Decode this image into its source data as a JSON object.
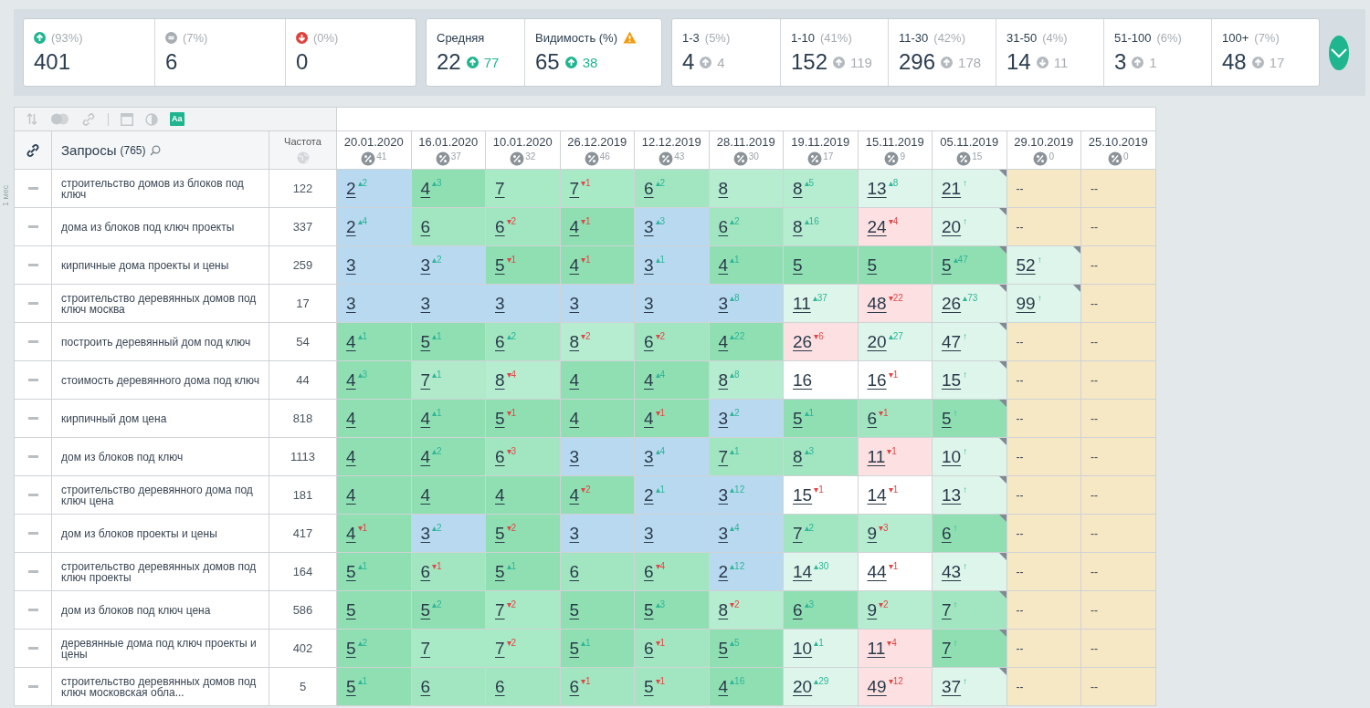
{
  "summary": {
    "trend": [
      {
        "kind": "up",
        "percent": "(93%)",
        "value": "401"
      },
      {
        "kind": "same",
        "percent": "(7%)",
        "value": "6"
      },
      {
        "kind": "down",
        "percent": "(0%)",
        "value": "0"
      }
    ],
    "metrics": [
      {
        "label": "Средняя",
        "warning": false,
        "value": "22",
        "delta": "77",
        "kind": "up"
      },
      {
        "label": "Видимость (%)",
        "warning": true,
        "value": "65",
        "delta": "38",
        "kind": "up"
      }
    ],
    "ranges": [
      {
        "label": "1-3",
        "percent": "(5%)",
        "value": "4",
        "delta": "4",
        "kind": "up"
      },
      {
        "label": "1-10",
        "percent": "(41%)",
        "value": "152",
        "delta": "119",
        "kind": "up"
      },
      {
        "label": "11-30",
        "percent": "(42%)",
        "value": "296",
        "delta": "178",
        "kind": "up"
      },
      {
        "label": "31-50",
        "percent": "(4%)",
        "value": "14",
        "delta": "11",
        "kind": "down"
      },
      {
        "label": "51-100",
        "percent": "(6%)",
        "value": "3",
        "delta": "1",
        "kind": "up"
      },
      {
        "label": "100+",
        "percent": "(7%)",
        "value": "48",
        "delta": "17",
        "kind": "up"
      }
    ]
  },
  "side_label": "1 мес",
  "toolbar": [
    {
      "kind": "sort",
      "active": false
    },
    {
      "kind": "toggle",
      "active": false
    },
    {
      "kind": "link",
      "active": false
    },
    {
      "kind": "separator"
    },
    {
      "kind": "window",
      "active": false
    },
    {
      "kind": "contrast",
      "active": false
    },
    {
      "kind": "text",
      "label": "Aa",
      "active": true
    }
  ],
  "table": {
    "query_header": "Запросы",
    "query_count": "(765)",
    "freq_header": "Частота",
    "dates": [
      {
        "date": "20.01.2020",
        "visibility": "41"
      },
      {
        "date": "16.01.2020",
        "visibility": "37"
      },
      {
        "date": "10.01.2020",
        "visibility": "32"
      },
      {
        "date": "26.12.2019",
        "visibility": "46"
      },
      {
        "date": "12.12.2019",
        "visibility": "43"
      },
      {
        "date": "28.11.2019",
        "visibility": "30"
      },
      {
        "date": "19.11.2019",
        "visibility": "17"
      },
      {
        "date": "15.11.2019",
        "visibility": "9"
      },
      {
        "date": "05.11.2019",
        "visibility": "15"
      },
      {
        "date": "29.10.2019",
        "visibility": "0"
      },
      {
        "date": "25.10.2019",
        "visibility": "0"
      }
    ],
    "rows": [
      {
        "query": "строительство домов из блоков под ключ",
        "frequency": "122",
        "cells": [
          {
            "kind": "up",
            "value": "2",
            "delta": "▴2",
            "color": "#b9d9f1",
            "flagged": false
          },
          {
            "kind": "up",
            "value": "4",
            "delta": "▴3",
            "color": "#8fdfb2",
            "flagged": false
          },
          {
            "kind": "same",
            "value": "7",
            "color": "#a8e9c6",
            "flagged": false
          },
          {
            "kind": "down",
            "value": "7",
            "delta": "▾1",
            "color": "#a8e9c6",
            "flagged": false
          },
          {
            "kind": "up",
            "value": "6",
            "delta": "▴2",
            "color": "#a2e6c1",
            "flagged": false
          },
          {
            "kind": "same",
            "value": "8",
            "color": "#b6ecd0",
            "flagged": false
          },
          {
            "kind": "up",
            "value": "8",
            "delta": "▴5",
            "color": "#b6ecd0",
            "flagged": false
          },
          {
            "kind": "up",
            "value": "13",
            "delta": "▴8",
            "color": "#ddf5ea",
            "flagged": false
          },
          {
            "kind": "new",
            "value": "21",
            "delta": "↑",
            "color": "#ddf5ea",
            "flagged": true
          },
          {
            "kind": "empty",
            "value": "--",
            "color": "#f6e7c5",
            "flagged": false
          },
          {
            "kind": "empty",
            "value": "--",
            "color": "#f6e7c5",
            "flagged": false
          }
        ]
      },
      {
        "query": "дома из блоков под ключ проекты",
        "frequency": "337",
        "cells": [
          {
            "kind": "up",
            "value": "2",
            "delta": "▴4",
            "color": "#b9d9f1",
            "flagged": false
          },
          {
            "kind": "same",
            "value": "6",
            "color": "#a2e6c1",
            "flagged": false
          },
          {
            "kind": "down",
            "value": "6",
            "delta": "▾2",
            "color": "#a2e6c1",
            "flagged": false
          },
          {
            "kind": "down",
            "value": "4",
            "delta": "▾1",
            "color": "#8fdfb2",
            "flagged": false
          },
          {
            "kind": "up",
            "value": "3",
            "delta": "▴3",
            "color": "#b9d9f1",
            "flagged": false
          },
          {
            "kind": "up",
            "value": "6",
            "delta": "▴2",
            "color": "#a2e6c1",
            "flagged": false
          },
          {
            "kind": "up",
            "value": "8",
            "delta": "▴16",
            "color": "#b6ecd0",
            "flagged": false
          },
          {
            "kind": "down",
            "value": "24",
            "delta": "▾4",
            "color": "#fde1e2",
            "flagged": false
          },
          {
            "kind": "new",
            "value": "20",
            "delta": "↑",
            "color": "#ddf5ea",
            "flagged": true
          },
          {
            "kind": "empty",
            "value": "--",
            "color": "#f6e7c5",
            "flagged": false
          },
          {
            "kind": "empty",
            "value": "--",
            "color": "#f6e7c5",
            "flagged": false
          }
        ]
      },
      {
        "query": "кирпичные дома проекты и цены",
        "frequency": "259",
        "cells": [
          {
            "kind": "same",
            "value": "3",
            "color": "#b9d9f1",
            "flagged": false
          },
          {
            "kind": "up",
            "value": "3",
            "delta": "▴2",
            "color": "#b9d9f1",
            "flagged": false
          },
          {
            "kind": "down",
            "value": "5",
            "delta": "▾1",
            "color": "#8fdfb2",
            "flagged": false
          },
          {
            "kind": "down",
            "value": "4",
            "delta": "▾1",
            "color": "#8fdfb2",
            "flagged": false
          },
          {
            "kind": "up",
            "value": "3",
            "delta": "▴1",
            "color": "#b9d9f1",
            "flagged": false
          },
          {
            "kind": "up",
            "value": "4",
            "delta": "▴1",
            "color": "#8fdfb2",
            "flagged": false
          },
          {
            "kind": "same",
            "value": "5",
            "color": "#8fdfb2",
            "flagged": false
          },
          {
            "kind": "same",
            "value": "5",
            "color": "#8fdfb2",
            "flagged": false
          },
          {
            "kind": "up",
            "value": "5",
            "delta": "▴47",
            "color": "#8fdfb2",
            "flagged": true
          },
          {
            "kind": "new",
            "value": "52",
            "delta": "↑",
            "color": "#ddf5ea",
            "flagged": true
          },
          {
            "kind": "empty",
            "value": "--",
            "color": "#f6e7c5",
            "flagged": false
          }
        ]
      },
      {
        "query": "строительство деревянных домов под ключ москва",
        "frequency": "17",
        "cells": [
          {
            "kind": "same",
            "value": "3",
            "color": "#b9d9f1",
            "flagged": false
          },
          {
            "kind": "same",
            "value": "3",
            "color": "#b9d9f1",
            "flagged": false
          },
          {
            "kind": "same",
            "value": "3",
            "color": "#b9d9f1",
            "flagged": false
          },
          {
            "kind": "same",
            "value": "3",
            "color": "#b9d9f1",
            "flagged": false
          },
          {
            "kind": "same",
            "value": "3",
            "color": "#b9d9f1",
            "flagged": false
          },
          {
            "kind": "up",
            "value": "3",
            "delta": "▴8",
            "color": "#b9d9f1",
            "flagged": false
          },
          {
            "kind": "up",
            "value": "11",
            "delta": "▴37",
            "color": "#ddf5ea",
            "flagged": false
          },
          {
            "kind": "down",
            "value": "48",
            "delta": "▾22",
            "color": "#fde1e2",
            "flagged": false
          },
          {
            "kind": "up",
            "value": "26",
            "delta": "▴73",
            "color": "#ddf5ea",
            "flagged": true
          },
          {
            "kind": "new",
            "value": "99",
            "delta": "↑",
            "color": "#ddf5ea",
            "flagged": true
          },
          {
            "kind": "empty",
            "value": "--",
            "color": "#f6e7c5",
            "flagged": false
          }
        ]
      },
      {
        "query": "построить деревянный дом под ключ",
        "frequency": "54",
        "cells": [
          {
            "kind": "up",
            "value": "4",
            "delta": "▴1",
            "color": "#8fdfb2",
            "flagged": false
          },
          {
            "kind": "up",
            "value": "5",
            "delta": "▴1",
            "color": "#8fdfb2",
            "flagged": false
          },
          {
            "kind": "up",
            "value": "6",
            "delta": "▴2",
            "color": "#a2e6c1",
            "flagged": false
          },
          {
            "kind": "down",
            "value": "8",
            "delta": "▾2",
            "color": "#b6ecd0",
            "flagged": false
          },
          {
            "kind": "down",
            "value": "6",
            "delta": "▾2",
            "color": "#a2e6c1",
            "flagged": false
          },
          {
            "kind": "up",
            "value": "4",
            "delta": "▴22",
            "color": "#8fdfb2",
            "flagged": false
          },
          {
            "kind": "down",
            "value": "26",
            "delta": "▾6",
            "color": "#fde1e2",
            "flagged": false
          },
          {
            "kind": "up",
            "value": "20",
            "delta": "▴27",
            "color": "#ddf5ea",
            "flagged": false
          },
          {
            "kind": "new",
            "value": "47",
            "delta": "↑",
            "color": "#ddf5ea",
            "flagged": true
          },
          {
            "kind": "empty",
            "value": "--",
            "color": "#f6e7c5",
            "flagged": false
          },
          {
            "kind": "empty",
            "value": "--",
            "color": "#f6e7c5",
            "flagged": false
          }
        ]
      },
      {
        "query": "стоимость деревянного дома под ключ",
        "frequency": "44",
        "cells": [
          {
            "kind": "up",
            "value": "4",
            "delta": "▴3",
            "color": "#8fdfb2",
            "flagged": false
          },
          {
            "kind": "up",
            "value": "7",
            "delta": "▴1",
            "color": "#b0eacb",
            "flagged": false
          },
          {
            "kind": "down",
            "value": "8",
            "delta": "▾4",
            "color": "#b6ecd0",
            "flagged": false
          },
          {
            "kind": "same",
            "value": "4",
            "color": "#8fdfb2",
            "flagged": false
          },
          {
            "kind": "up",
            "value": "4",
            "delta": "▴4",
            "color": "#8fdfb2",
            "flagged": false
          },
          {
            "kind": "up",
            "value": "8",
            "delta": "▴8",
            "color": "#b6ecd0",
            "flagged": false
          },
          {
            "kind": "same",
            "value": "16",
            "color": "#ffffff",
            "flagged": false
          },
          {
            "kind": "down",
            "value": "16",
            "delta": "▾1",
            "color": "#ffffff",
            "flagged": false
          },
          {
            "kind": "new",
            "value": "15",
            "delta": "↑",
            "color": "#ddf5ea",
            "flagged": true
          },
          {
            "kind": "empty",
            "value": "--",
            "color": "#f6e7c5",
            "flagged": false
          },
          {
            "kind": "empty",
            "value": "--",
            "color": "#f6e7c5",
            "flagged": false
          }
        ]
      },
      {
        "query": "кирпичный дом цена",
        "frequency": "818",
        "cells": [
          {
            "kind": "same",
            "value": "4",
            "color": "#8fdfb2",
            "flagged": false
          },
          {
            "kind": "up",
            "value": "4",
            "delta": "▴1",
            "color": "#8fdfb2",
            "flagged": false
          },
          {
            "kind": "down",
            "value": "5",
            "delta": "▾1",
            "color": "#8fdfb2",
            "flagged": false
          },
          {
            "kind": "same",
            "value": "4",
            "color": "#8fdfb2",
            "flagged": false
          },
          {
            "kind": "down",
            "value": "4",
            "delta": "▾1",
            "color": "#8fdfb2",
            "flagged": false
          },
          {
            "kind": "up",
            "value": "3",
            "delta": "▴2",
            "color": "#b9d9f1",
            "flagged": false
          },
          {
            "kind": "up",
            "value": "5",
            "delta": "▴1",
            "color": "#8fdfb2",
            "flagged": false
          },
          {
            "kind": "down",
            "value": "6",
            "delta": "▾1",
            "color": "#a2e6c1",
            "flagged": false
          },
          {
            "kind": "new",
            "value": "5",
            "delta": "↑",
            "color": "#8fdfb2",
            "flagged": true
          },
          {
            "kind": "empty",
            "value": "--",
            "color": "#f6e7c5",
            "flagged": false
          },
          {
            "kind": "empty",
            "value": "--",
            "color": "#f6e7c5",
            "flagged": false
          }
        ]
      },
      {
        "query": "дом из блоков под ключ",
        "frequency": "1113",
        "cells": [
          {
            "kind": "same",
            "value": "4",
            "color": "#8fdfb2",
            "flagged": false
          },
          {
            "kind": "up",
            "value": "4",
            "delta": "▴2",
            "color": "#8fdfb2",
            "flagged": false
          },
          {
            "kind": "down",
            "value": "6",
            "delta": "▾3",
            "color": "#a2e6c1",
            "flagged": false
          },
          {
            "kind": "same",
            "value": "3",
            "color": "#b9d9f1",
            "flagged": false
          },
          {
            "kind": "up",
            "value": "3",
            "delta": "▴4",
            "color": "#b9d9f1",
            "flagged": false
          },
          {
            "kind": "up",
            "value": "7",
            "delta": "▴1",
            "color": "#a2e6c1",
            "flagged": false
          },
          {
            "kind": "up",
            "value": "8",
            "delta": "▴3",
            "color": "#a2e6c1",
            "flagged": false
          },
          {
            "kind": "down",
            "value": "11",
            "delta": "▾1",
            "color": "#fde1e2",
            "flagged": false
          },
          {
            "kind": "new",
            "value": "10",
            "delta": "↑",
            "color": "#ddf5ea",
            "flagged": true
          },
          {
            "kind": "empty",
            "value": "--",
            "color": "#f6e7c5",
            "flagged": false
          },
          {
            "kind": "empty",
            "value": "--",
            "color": "#f6e7c5",
            "flagged": false
          }
        ]
      },
      {
        "query": "строительство деревянного дома под ключ цена",
        "frequency": "181",
        "cells": [
          {
            "kind": "same",
            "value": "4",
            "color": "#8fdfb2",
            "flagged": false
          },
          {
            "kind": "same",
            "value": "4",
            "color": "#8fdfb2",
            "flagged": false
          },
          {
            "kind": "same",
            "value": "4",
            "color": "#8fdfb2",
            "flagged": false
          },
          {
            "kind": "down",
            "value": "4",
            "delta": "▾2",
            "color": "#8fdfb2",
            "flagged": false
          },
          {
            "kind": "up",
            "value": "2",
            "delta": "▴1",
            "color": "#b9d9f1",
            "flagged": false
          },
          {
            "kind": "up",
            "value": "3",
            "delta": "▴12",
            "color": "#b9d9f1",
            "flagged": false
          },
          {
            "kind": "down",
            "value": "15",
            "delta": "▾1",
            "color": "#ffffff",
            "flagged": false
          },
          {
            "kind": "down",
            "value": "14",
            "delta": "▾1",
            "color": "#ffffff",
            "flagged": false
          },
          {
            "kind": "new",
            "value": "13",
            "delta": "↑",
            "color": "#ddf5ea",
            "flagged": true
          },
          {
            "kind": "empty",
            "value": "--",
            "color": "#f6e7c5",
            "flagged": false
          },
          {
            "kind": "empty",
            "value": "--",
            "color": "#f6e7c5",
            "flagged": false
          }
        ]
      },
      {
        "query": "дом из блоков проекты и цены",
        "frequency": "417",
        "cells": [
          {
            "kind": "down",
            "value": "4",
            "delta": "▾1",
            "color": "#8fdfb2",
            "flagged": false
          },
          {
            "kind": "up",
            "value": "3",
            "delta": "▴2",
            "color": "#b9d9f1",
            "flagged": false
          },
          {
            "kind": "down",
            "value": "5",
            "delta": "▾2",
            "color": "#8fdfb2",
            "flagged": false
          },
          {
            "kind": "same",
            "value": "3",
            "color": "#b9d9f1",
            "flagged": false
          },
          {
            "kind": "same",
            "value": "3",
            "color": "#b9d9f1",
            "flagged": false
          },
          {
            "kind": "up",
            "value": "3",
            "delta": "▴4",
            "color": "#b9d9f1",
            "flagged": false
          },
          {
            "kind": "up",
            "value": "7",
            "delta": "▴2",
            "color": "#a2e6c1",
            "flagged": false
          },
          {
            "kind": "down",
            "value": "9",
            "delta": "▾3",
            "color": "#b6ecd0",
            "flagged": false
          },
          {
            "kind": "new",
            "value": "6",
            "delta": "↑",
            "color": "#8fdfb2",
            "flagged": true
          },
          {
            "kind": "empty",
            "value": "--",
            "color": "#f6e7c5",
            "flagged": false
          },
          {
            "kind": "empty",
            "value": "--",
            "color": "#f6e7c5",
            "flagged": false
          }
        ]
      },
      {
        "query": "строительство деревянных домов под ключ проекты",
        "frequency": "164",
        "cells": [
          {
            "kind": "up",
            "value": "5",
            "delta": "▴1",
            "color": "#8fdfb2",
            "flagged": false
          },
          {
            "kind": "down",
            "value": "6",
            "delta": "▾1",
            "color": "#a2e6c1",
            "flagged": false
          },
          {
            "kind": "up",
            "value": "5",
            "delta": "▴1",
            "color": "#8fdfb2",
            "flagged": false
          },
          {
            "kind": "same",
            "value": "6",
            "color": "#a2e6c1",
            "flagged": false
          },
          {
            "kind": "down",
            "value": "6",
            "delta": "▾4",
            "color": "#a2e6c1",
            "flagged": false
          },
          {
            "kind": "up",
            "value": "2",
            "delta": "▴12",
            "color": "#b9d9f1",
            "flagged": false
          },
          {
            "kind": "up",
            "value": "14",
            "delta": "▴30",
            "color": "#ddf5ea",
            "flagged": false
          },
          {
            "kind": "down",
            "value": "44",
            "delta": "▾1",
            "color": "#ffffff",
            "flagged": false
          },
          {
            "kind": "new",
            "value": "43",
            "delta": "↑",
            "color": "#ddf5ea",
            "flagged": true
          },
          {
            "kind": "empty",
            "value": "--",
            "color": "#f6e7c5",
            "flagged": false
          },
          {
            "kind": "empty",
            "value": "--",
            "color": "#f6e7c5",
            "flagged": false
          }
        ]
      },
      {
        "query": "дом из блоков под ключ цена",
        "frequency": "586",
        "cells": [
          {
            "kind": "same",
            "value": "5",
            "color": "#8fdfb2",
            "flagged": false
          },
          {
            "kind": "up",
            "value": "5",
            "delta": "▴2",
            "color": "#8fdfb2",
            "flagged": false
          },
          {
            "kind": "down",
            "value": "7",
            "delta": "▾2",
            "color": "#a8e9c6",
            "flagged": false
          },
          {
            "kind": "same",
            "value": "5",
            "color": "#8fdfb2",
            "flagged": false
          },
          {
            "kind": "up",
            "value": "5",
            "delta": "▴3",
            "color": "#8fdfb2",
            "flagged": false
          },
          {
            "kind": "down",
            "value": "8",
            "delta": "▾2",
            "color": "#b6ecd0",
            "flagged": false
          },
          {
            "kind": "up",
            "value": "6",
            "delta": "▴3",
            "color": "#8fdfb2",
            "flagged": false
          },
          {
            "kind": "down",
            "value": "9",
            "delta": "▾2",
            "color": "#b6ecd0",
            "flagged": false
          },
          {
            "kind": "new",
            "value": "7",
            "delta": "↑",
            "color": "#a2e6c1",
            "flagged": true
          },
          {
            "kind": "empty",
            "value": "--",
            "color": "#f6e7c5",
            "flagged": false
          },
          {
            "kind": "empty",
            "value": "--",
            "color": "#f6e7c5",
            "flagged": false
          }
        ]
      },
      {
        "query": "деревянные дома под ключ проекты и цены",
        "frequency": "402",
        "cells": [
          {
            "kind": "up",
            "value": "5",
            "delta": "▴2",
            "color": "#8fdfb2",
            "flagged": false
          },
          {
            "kind": "same",
            "value": "7",
            "color": "#a8e9c6",
            "flagged": false
          },
          {
            "kind": "down",
            "value": "7",
            "delta": "▾2",
            "color": "#a8e9c6",
            "flagged": false
          },
          {
            "kind": "up",
            "value": "5",
            "delta": "▴1",
            "color": "#8fdfb2",
            "flagged": false
          },
          {
            "kind": "down",
            "value": "6",
            "delta": "▾1",
            "color": "#a2e6c1",
            "flagged": false
          },
          {
            "kind": "up",
            "value": "5",
            "delta": "▴5",
            "color": "#8fdfb2",
            "flagged": false
          },
          {
            "kind": "up",
            "value": "10",
            "delta": "▴1",
            "color": "#ddf5ea",
            "flagged": false
          },
          {
            "kind": "down",
            "value": "11",
            "delta": "▾4",
            "color": "#fde1e2",
            "flagged": false
          },
          {
            "kind": "new",
            "value": "7",
            "delta": "↑",
            "color": "#8fdfb2",
            "flagged": true
          },
          {
            "kind": "empty",
            "value": "--",
            "color": "#f6e7c5",
            "flagged": false
          },
          {
            "kind": "empty",
            "value": "--",
            "color": "#f6e7c5",
            "flagged": false
          }
        ]
      },
      {
        "query": "строительство деревянных домов под ключ московская обла...",
        "frequency": "5",
        "cells": [
          {
            "kind": "up",
            "value": "5",
            "delta": "▴1",
            "color": "#8fdfb2",
            "flagged": false
          },
          {
            "kind": "same",
            "value": "6",
            "color": "#a2e6c1",
            "flagged": false
          },
          {
            "kind": "same",
            "value": "6",
            "color": "#a2e6c1",
            "flagged": false
          },
          {
            "kind": "down",
            "value": "6",
            "delta": "▾1",
            "color": "#a2e6c1",
            "flagged": false
          },
          {
            "kind": "down",
            "value": "5",
            "delta": "▾1",
            "color": "#a2e6c1",
            "flagged": false
          },
          {
            "kind": "up",
            "value": "4",
            "delta": "▴16",
            "color": "#8fdfb2",
            "flagged": false
          },
          {
            "kind": "up",
            "value": "20",
            "delta": "▴29",
            "color": "#ddf5ea",
            "flagged": false
          },
          {
            "kind": "down",
            "value": "49",
            "delta": "▾12",
            "color": "#fde1e2",
            "flagged": false
          },
          {
            "kind": "new",
            "value": "37",
            "delta": "↑",
            "color": "#ddf5ea",
            "flagged": true
          },
          {
            "kind": "empty",
            "value": "--",
            "color": "#f6e7c5",
            "flagged": false
          },
          {
            "kind": "empty",
            "value": "--",
            "color": "#f6e7c5",
            "flagged": false
          }
        ]
      }
    ]
  }
}
